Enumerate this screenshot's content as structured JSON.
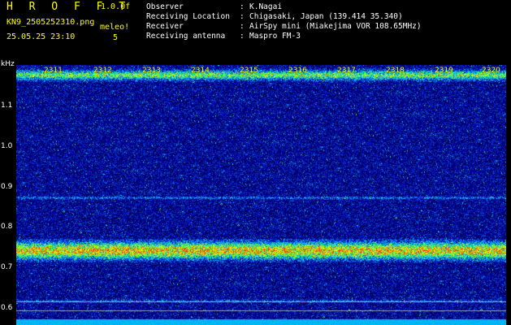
{
  "header": {
    "title": "H R O F F T",
    "version": "1.0.0f",
    "filename": "KN9_2505252310.png",
    "datetime": "25.05.25 23:10",
    "meleo_label": "meleo!",
    "meleo_count": "5"
  },
  "info": [
    {
      "label": "Observer",
      "value": "K.Nagai"
    },
    {
      "label": "Receiving Location",
      "value": "Chigasaki, Japan (139.414 35.340)"
    },
    {
      "label": "Receiver",
      "value": "AirSpy mini (Miakejima VOR 108.65MHz)"
    },
    {
      "label": "Receiving antenna",
      "value": "Maspro FM-3"
    }
  ],
  "yaxis": {
    "unit": "kHz",
    "ticks": [
      "1.1",
      "1.0",
      "0.9",
      "0.8",
      "0.7",
      "0.6"
    ]
  },
  "time_labels": [
    "2311",
    "2312",
    "2313",
    "2314",
    "2315",
    "2316",
    "2317",
    "2318",
    "2319",
    "2320"
  ],
  "colors": {
    "background": "#000000",
    "header_text": "#ffff00",
    "info_text": "#ffffff",
    "time_label": "#ffff00"
  }
}
